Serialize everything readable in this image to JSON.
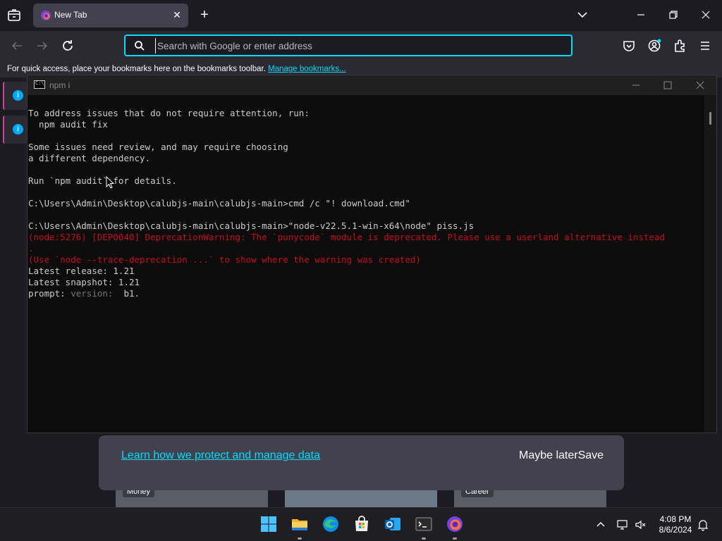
{
  "browser": {
    "tab": {
      "title": "New Tab"
    },
    "urlbar": {
      "placeholder": "Search with Google or enter address"
    },
    "bookmarks_bar": {
      "message": "For quick access, place your bookmarks here on the bookmarks toolbar.",
      "manage_link": "Manage bookmarks..."
    }
  },
  "page": {
    "privacy_notice": {
      "learn_link": "Learn how we protect and manage data",
      "maybe_later": "Maybe later",
      "save": "Save"
    },
    "thumbnails": [
      {
        "label": "Money"
      },
      {
        "label": ""
      },
      {
        "label": "Career"
      }
    ]
  },
  "console_window": {
    "title": "npm i",
    "lines": [
      {
        "text": "To address issues that do not require attention, run:",
        "style": "normal"
      },
      {
        "text": "  npm audit fix",
        "style": "normal"
      },
      {
        "text": "",
        "style": "normal"
      },
      {
        "text": "Some issues need review, and may require choosing",
        "style": "normal"
      },
      {
        "text": "a different dependency.",
        "style": "normal"
      },
      {
        "text": "",
        "style": "normal"
      },
      {
        "text": "Run `npm audit` for details.",
        "style": "normal"
      },
      {
        "text": "",
        "style": "normal"
      },
      {
        "text": "C:\\Users\\Admin\\Desktop\\calubjs-main\\calubjs-main>cmd /c \"! download.cmd\"",
        "style": "normal"
      },
      {
        "text": "",
        "style": "normal"
      },
      {
        "text": "C:\\Users\\Admin\\Desktop\\calubjs-main\\calubjs-main>\"node-v22.5.1-win-x64\\node\" piss.js",
        "style": "normal"
      },
      {
        "text": "(node:5276) [DEP0040] DeprecationWarning: The `punycode` module is deprecated. Please use a userland alternative instead",
        "style": "red"
      },
      {
        "text": ".",
        "style": "red"
      },
      {
        "text": "(Use `node --trace-deprecation ...` to show where the warning was created)",
        "style": "red"
      },
      {
        "text": "Latest release: 1.21",
        "style": "normal"
      },
      {
        "text": "Latest snapshot: 1.21",
        "style": "normal"
      }
    ],
    "prompt": {
      "label": "prompt:",
      "hint": " version: ",
      "input": " b1."
    }
  },
  "taskbar": {
    "apps": [
      "start-icon",
      "file-explorer-icon",
      "edge-icon",
      "store-icon",
      "outlook-icon",
      "terminal-icon",
      "firefox-icon"
    ],
    "time": "4:08 PM",
    "date": "8/6/2024"
  }
}
